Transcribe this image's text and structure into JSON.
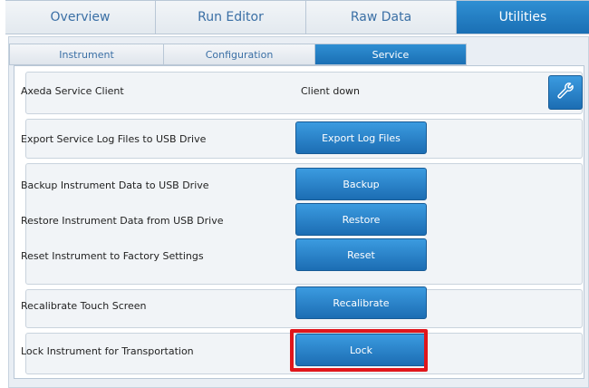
{
  "top_tabs": [
    {
      "label": "Overview",
      "active": false
    },
    {
      "label": "Run Editor",
      "active": false
    },
    {
      "label": "Raw Data",
      "active": false
    },
    {
      "label": "Utilities",
      "active": true
    }
  ],
  "sub_tabs": [
    {
      "label": "Instrument",
      "active": false
    },
    {
      "label": "Configuration",
      "active": false
    },
    {
      "label": "Service",
      "active": true
    }
  ],
  "service": {
    "axeda": {
      "label": "Axeda Service Client",
      "status": "Client down",
      "icon": "wrench-icon"
    },
    "export": {
      "label": "Export Service Log Files to USB Drive",
      "button": "Export Log Files"
    },
    "backup": {
      "label": "Backup Instrument Data to USB Drive",
      "button": "Backup"
    },
    "restore": {
      "label": "Restore Instrument Data from USB Drive",
      "button": "Restore"
    },
    "reset": {
      "label": "Reset Instrument to Factory Settings",
      "button": "Reset"
    },
    "recalibrate": {
      "label": "Recalibrate Touch Screen",
      "button": "Recalibrate"
    },
    "lock": {
      "label": "Lock Instrument for Transportation",
      "button": "Lock"
    }
  },
  "colors": {
    "accent": "#1c6db3",
    "highlight": "#e0161b",
    "tab_text": "#3a6fa5"
  }
}
